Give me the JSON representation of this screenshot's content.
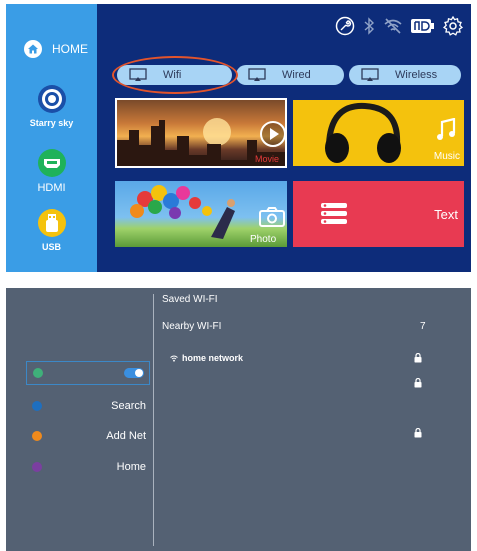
{
  "launcher": {
    "sidebar": {
      "home_label": "HOME",
      "items": [
        {
          "label": "Starry sky",
          "icon": "target-icon"
        },
        {
          "label": "HDMI",
          "icon": "hdmi-icon"
        },
        {
          "label": "USB",
          "icon": "usb-drive-icon"
        }
      ]
    },
    "status_icons": [
      "tools-icon",
      "bluetooth-icon",
      "wifi-off-icon",
      "battery-icon",
      "gear-icon"
    ],
    "cast_tabs": [
      {
        "label": "Wifi",
        "selected": true
      },
      {
        "label": "Wired"
      },
      {
        "label": "Wireless"
      }
    ],
    "tiles": [
      {
        "label": "Movie",
        "icon": "play-icon"
      },
      {
        "label": "Music",
        "icon": "music-note-icon"
      },
      {
        "label": "Photo",
        "icon": "camera-icon"
      },
      {
        "label": "Text",
        "icon": "text-lines-icon"
      }
    ],
    "colors": {
      "background": "#0d2c7a",
      "sidebar": "#3a9de6",
      "highlight_ring": "#e2542c",
      "music_tile": "#f4c20d",
      "text_tile": "#e83a52"
    }
  },
  "wifi_settings": {
    "menu": [
      {
        "label": "",
        "toggle_on": true,
        "dot_color": "#3fb07a"
      },
      {
        "label": "Search",
        "dot_color": "#1e6fc0"
      },
      {
        "label": "Add Net",
        "dot_color": "#f08a1c"
      },
      {
        "label": "Home",
        "dot_color": "#7b3fa0"
      }
    ],
    "saved_header": "Saved WI-FI",
    "nearby_header": "Nearby WI-FI",
    "nearby_count": "7",
    "networks": [
      {
        "name": "home network",
        "locked": true
      },
      {
        "name": "",
        "locked": true
      },
      {
        "name": "",
        "locked": true
      }
    ]
  }
}
